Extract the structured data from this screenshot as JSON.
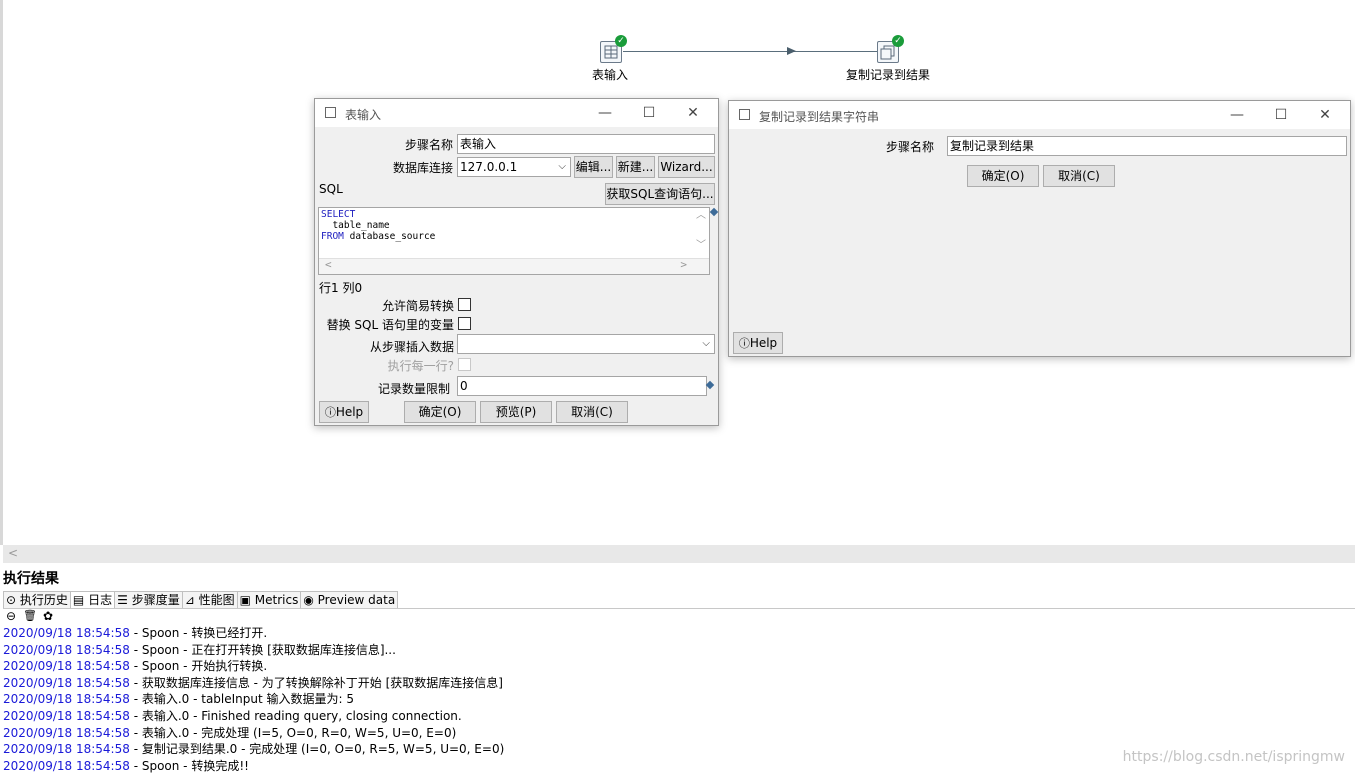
{
  "canvas": {
    "steps": [
      {
        "label": "表输入",
        "icon": "table-input-icon",
        "status": "ok"
      },
      {
        "label": "复制记录到结果",
        "icon": "copy-rows-icon",
        "status": "ok"
      }
    ]
  },
  "table_input_dialog": {
    "title": "表输入",
    "step_name_label": "步骤名称",
    "step_name_value": "表输入",
    "db_conn_label": "数据库连接",
    "db_conn_value": "127.0.0.1",
    "edit_button": "编辑...",
    "new_button": "新建...",
    "wizard_button": "Wizard...",
    "sql_label": "SQL",
    "get_sql_button": "获取SQL查询语句...",
    "sql_lines": [
      {
        "kw": "SELECT",
        "rest": ""
      },
      {
        "kw": "",
        "rest": "  table_name"
      },
      {
        "kw": "FROM",
        "rest": " database_source"
      }
    ],
    "cursor_pos": "行1 列0",
    "allow_lazy_label": "允许简易转换",
    "replace_vars_label": "替换 SQL 语句里的变量",
    "insert_from_step_label": "从步骤插入数据",
    "insert_from_step_value": "",
    "execute_each_row_label": "执行每一行?",
    "limit_label": "记录数量限制",
    "limit_value": "0",
    "help_button": "Help",
    "ok_button": "确定(O)",
    "preview_button": "预览(P)",
    "cancel_button": "取消(C)"
  },
  "copy_rows_dialog": {
    "title": "复制记录到结果字符串",
    "step_name_label": "步骤名称",
    "step_name_value": "复制记录到结果",
    "ok_button": "确定(O)",
    "cancel_button": "取消(C)",
    "help_button": "Help"
  },
  "results": {
    "title": "执行结果",
    "tabs": [
      "执行历史",
      "日志",
      "步骤度量",
      "性能图",
      "Metrics",
      "Preview data"
    ],
    "active_tab": "日志",
    "log": [
      {
        "ts": "2020/09/18 18:54:58",
        "msg": " - Spoon - 转换已经打开."
      },
      {
        "ts": "2020/09/18 18:54:58",
        "msg": " - Spoon - 正在打开转换 [获取数据库连接信息]..."
      },
      {
        "ts": "2020/09/18 18:54:58",
        "msg": " - Spoon - 开始执行转换."
      },
      {
        "ts": "2020/09/18 18:54:58",
        "msg": " - 获取数据库连接信息 - 为了转换解除补丁开始  [获取数据库连接信息]"
      },
      {
        "ts": "2020/09/18 18:54:58",
        "msg": " - 表输入.0 - tableInput 输入数据量为: 5"
      },
      {
        "ts": "2020/09/18 18:54:58",
        "msg": " - 表输入.0 - Finished reading query, closing connection."
      },
      {
        "ts": "2020/09/18 18:54:58",
        "msg": " - 表输入.0 - 完成处理 (I=5, O=0, R=0, W=5, U=0, E=0)"
      },
      {
        "ts": "2020/09/18 18:54:58",
        "msg": " - 复制记录到结果.0 - 完成处理 (I=0, O=0, R=5, W=5, U=0, E=0)"
      },
      {
        "ts": "2020/09/18 18:54:58",
        "msg": " - Spoon - 转换完成!!"
      }
    ]
  },
  "watermark": "https://blog.csdn.net/ispringmw"
}
